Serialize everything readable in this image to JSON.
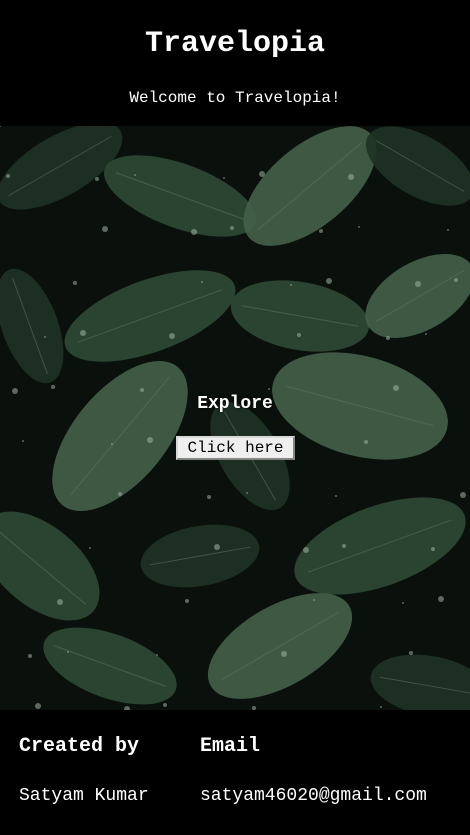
{
  "header": {
    "title": "Travelopia",
    "welcome": "Welcome to Travelopia!"
  },
  "hero": {
    "heading": "Explore",
    "button_label": "Click here",
    "background": "dark-green-leaves-photo"
  },
  "footer": {
    "columns": [
      {
        "heading": "Created by",
        "value": "Satyam Kumar"
      },
      {
        "heading": "Email",
        "value": "satyam46020@gmail.com"
      }
    ]
  },
  "colors": {
    "background": "#000000",
    "text": "#ffffff",
    "leaf_dark": "#1f3325",
    "leaf_mid": "#2f4a35",
    "leaf_light": "#44604a"
  }
}
